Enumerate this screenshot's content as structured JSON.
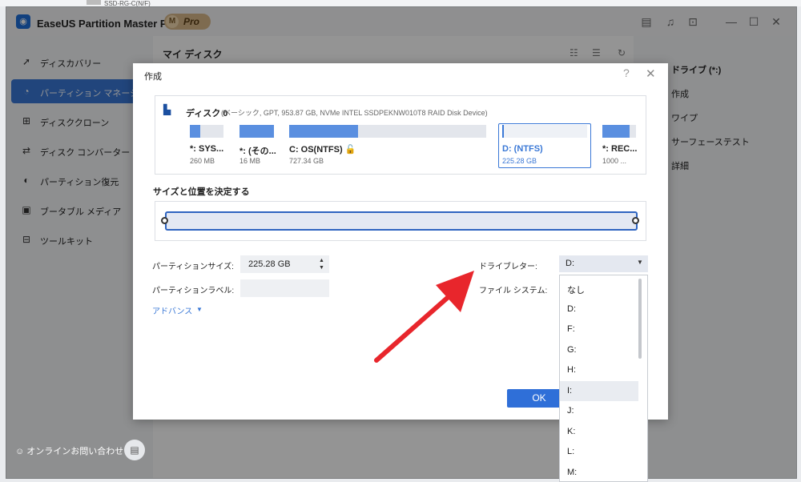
{
  "desktop": {
    "item_label": "SSD-RG-C(N/F)"
  },
  "app": {
    "title": "EaseUS Partition Master Pro版",
    "badge_m": "M",
    "badge_text": "Pro"
  },
  "sidebar": {
    "items": [
      {
        "label": "ディスカバリー",
        "icon": "compass-icon"
      },
      {
        "label": "パーティション マネージャー",
        "icon": "pie-chart-icon"
      },
      {
        "label": "ディスククローン",
        "icon": "clone-icon"
      },
      {
        "label": "ディスク コンバーター",
        "icon": "convert-icon"
      },
      {
        "label": "パーティション復元",
        "icon": "restore-icon"
      },
      {
        "label": "ブータブル メディア",
        "icon": "media-icon"
      },
      {
        "label": "ツールキット",
        "icon": "toolkit-icon"
      }
    ],
    "contact": "オンラインお問い合わせ"
  },
  "main": {
    "title": "マイ ディスク"
  },
  "right_panel": {
    "items": [
      "ドライブ (*:)",
      "作成",
      "ワイプ",
      "サーフェーステスト",
      "詳細"
    ]
  },
  "dialog": {
    "title": "作成",
    "help": "?",
    "close": "✕",
    "disk": {
      "name": "ディスク 0",
      "info": "(ベーシック, GPT, 953.87 GB, NVMe INTEL SSDPEKNW010T8 RAID Disk Device)",
      "partitions": [
        {
          "name": "*: SYS...",
          "size": "260 MB",
          "fill": 0.3
        },
        {
          "name": "*: (その...",
          "size": "16 MB",
          "fill": 1.0
        },
        {
          "name": "C: OS(NTFS)",
          "size": "727.34 GB",
          "fill": 0.35
        },
        {
          "name": "D: (NTFS)",
          "size": "225.28 GB",
          "fill": 0.0
        },
        {
          "name": "*: REC...",
          "size": "1000 ...",
          "fill": 0.8
        }
      ]
    },
    "size_position_label": "サイズと位置を決定する",
    "partition_size_label": "パーティションサイズ:",
    "partition_size_value": "225.28 GB",
    "partition_label_label": "パーティションラベル:",
    "advanced_label": "アドバンス",
    "drive_letter_label": "ドライブレター:",
    "file_system_label": "ファイル システム:",
    "ok_label": "OK"
  },
  "drive_letter": {
    "selected": "D:",
    "options": [
      "なし",
      "D:",
      "F:",
      "G:",
      "H:",
      "I:",
      "J:",
      "K:",
      "L:",
      "M:"
    ],
    "hovered_index": 5
  },
  "colors": {
    "accent": "#3a78d6",
    "arrow": "#e8262c"
  }
}
